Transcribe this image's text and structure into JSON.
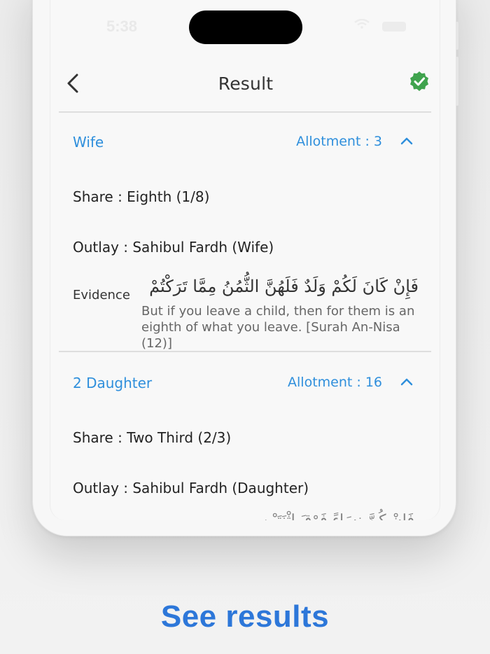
{
  "status_bar": {
    "time": "5:38"
  },
  "header": {
    "title": "Result"
  },
  "sections": [
    {
      "heir": "Wife",
      "allotment": "Allotment : 3",
      "share": "Share : Eighth (1/8)",
      "outlay": "Outlay : Sahibul Fardh (Wife)",
      "evidence_label": "Evidence",
      "evidence_arabic": "فَإِنْ كَانَ لَكُمْ وَلَدٌ فَلَهُنَّ الثُّمُنُ مِمَّا تَرَكْتُمْ",
      "evidence_translation": "But if you leave a child, then for them is an eighth of what you leave. [Surah An-Nisa (12)]"
    },
    {
      "heir": "2 Daughter",
      "allotment": "Allotment : 16",
      "share": "Share : Two Third (2/3)",
      "outlay": "Outlay : Sahibul Fardh (Daughter)",
      "evidence_arabic_partial": "فَإِنْ كُنَّ نِسَاءً فَوْقَ اثْنَتَيْنِ"
    }
  ],
  "caption": "See results",
  "colors": {
    "accent": "#2f8fdc",
    "verified": "#3fa34d",
    "caption": "#2d77d9"
  }
}
